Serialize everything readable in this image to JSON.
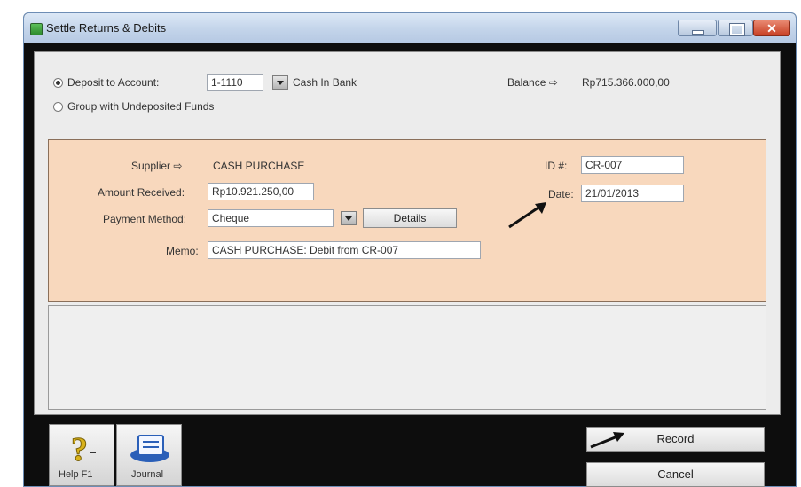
{
  "window": {
    "title": "Settle Returns & Debits",
    "close_glyph": "✕"
  },
  "deposit": {
    "deposit_label": "Deposit to Account:",
    "account_code": "1-1110",
    "account_name": "Cash In Bank",
    "group_label": "Group with Undeposited Funds",
    "balance_label": "Balance ⇨",
    "balance_value": "Rp715.366.000,00",
    "selected_option": "deposit"
  },
  "form": {
    "supplier_label": "Supplier ⇨",
    "supplier_value": "CASH PURCHASE",
    "amount_label": "Amount Received:",
    "amount_value": "Rp10.921.250,00",
    "payment_label": "Payment Method:",
    "payment_value": "Cheque",
    "details_label": "Details",
    "memo_label": "Memo:",
    "memo_value": "CASH PURCHASE:  Debit from CR-007",
    "id_label": "ID #:",
    "id_value": "CR-007",
    "date_label": "Date:",
    "date_value": "21/01/2013"
  },
  "toolbar": {
    "help_label": "Help F1",
    "journal_label": "Journal",
    "record_label": "Record",
    "cancel_label": "Cancel"
  },
  "icons": [
    "window-app-icon",
    "help-icon",
    "journal-icon",
    "dropdown-arrow-icon",
    "arrow-pointer-icon"
  ]
}
